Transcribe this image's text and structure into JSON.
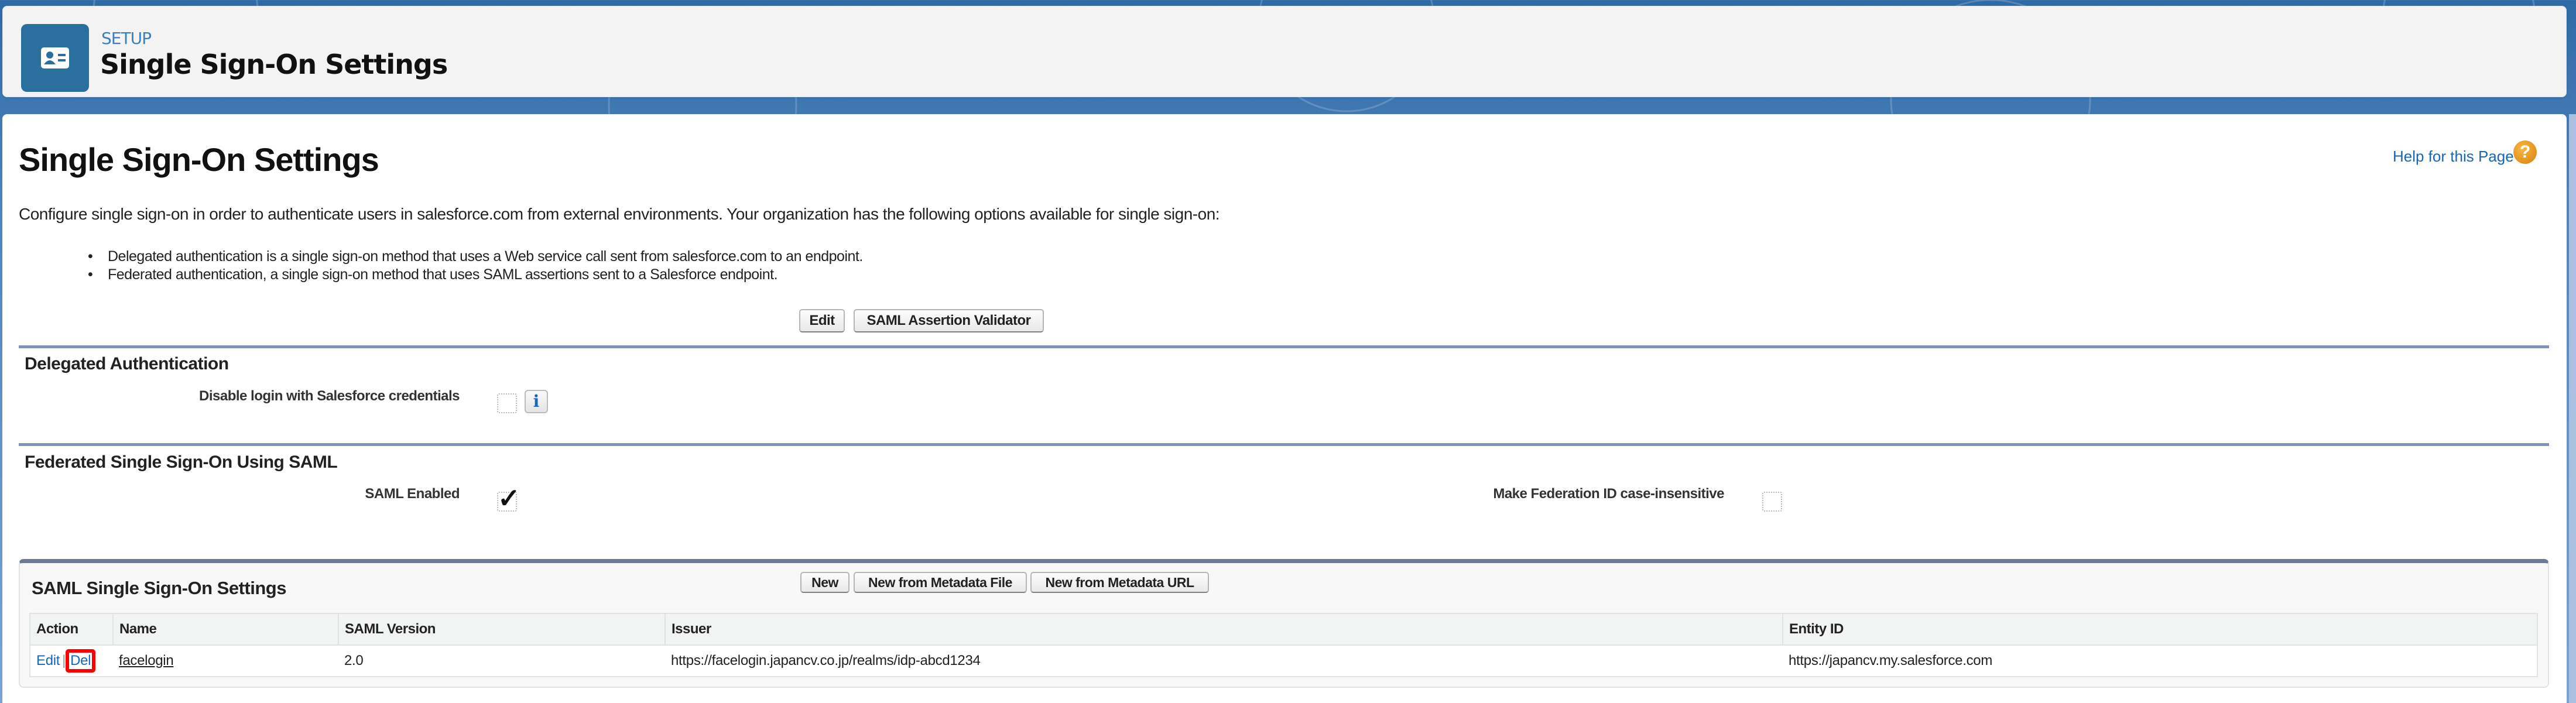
{
  "header": {
    "eyebrow": "SETUP",
    "title": "Single Sign-On Settings",
    "icon": "contact-card-icon"
  },
  "page": {
    "title": "Single Sign-On Settings",
    "help_link": "Help for this Page",
    "help_icon": "?",
    "description": "Configure single sign-on in order to authenticate users in salesforce.com from external environments. Your organization has the following options available for single sign-on:",
    "bullets": [
      "Delegated authentication is a single sign-on method that uses a Web service call sent from salesforce.com to an endpoint.",
      "Federated authentication, a single sign-on method that uses SAML assertions sent to a Salesforce endpoint."
    ],
    "buttons": {
      "edit": "Edit",
      "saml_validator": "SAML Assertion Validator"
    }
  },
  "delegated": {
    "heading": "Delegated Authentication",
    "fields": [
      {
        "label": "Disable login with Salesforce credentials",
        "checked": false,
        "info_icon": "i"
      }
    ]
  },
  "federated": {
    "heading": "Federated Single Sign-On Using SAML",
    "fields": [
      {
        "label": "SAML Enabled",
        "checked": true,
        "check_glyph": "✓"
      },
      {
        "label": "Make Federation ID case-insensitive",
        "checked": false
      }
    ]
  },
  "saml_settings": {
    "title": "SAML Single Sign-On Settings",
    "buttons": {
      "new": "New",
      "new_from_file": "New from Metadata File",
      "new_from_url": "New from Metadata URL"
    },
    "columns": [
      "Action",
      "Name",
      "SAML Version",
      "Issuer",
      "Entity ID"
    ],
    "rows": [
      {
        "action_edit": "Edit",
        "action_sep": "|",
        "action_del": "Del",
        "name": "facelogin",
        "saml_version": "2.0",
        "issuer": "https://facelogin.japancv.co.jp/realms/idp-abcd1234",
        "entity_id": "https://japancv.my.salesforce.com"
      }
    ]
  },
  "colors": {
    "brand_blue": "#2b6f9e",
    "link_blue": "#1667b8",
    "highlight_red": "#ff0000",
    "help_orange": "#e8920f"
  }
}
